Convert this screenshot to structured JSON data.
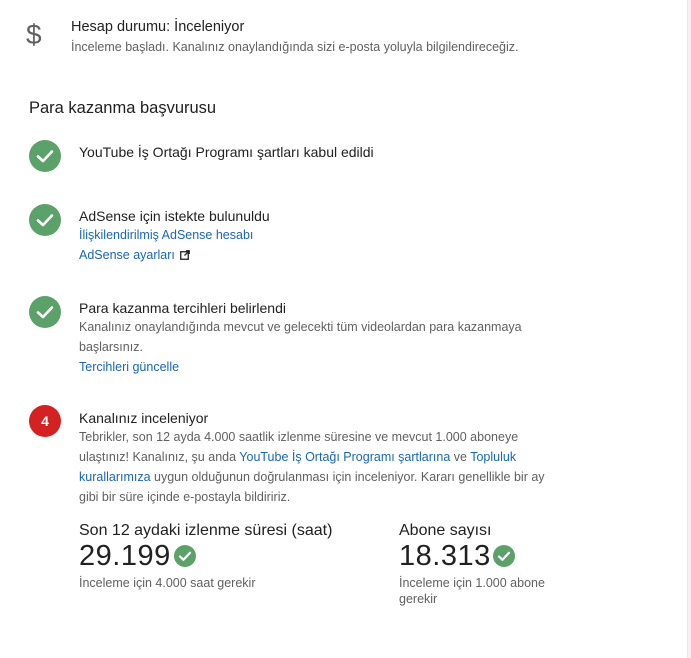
{
  "status": {
    "icon": "dollar-icon",
    "title": "Hesap durumu: İnceleniyor",
    "subtitle": "İnceleme başladı. Kanalınız onaylandığında sizi e-posta yoluyla bilgilendireceğiz."
  },
  "section_title": "Para kazanma başvurusu",
  "steps": [
    {
      "state": "done",
      "icon": "check-icon",
      "title": "YouTube İş Ortağı Programı şartları kabul edildi"
    },
    {
      "state": "done",
      "icon": "check-icon",
      "title": "AdSense için istekte bulunuldu",
      "links": [
        "İlişkilendirilmiş AdSense hesabı",
        "AdSense ayarları"
      ]
    },
    {
      "state": "done",
      "icon": "check-icon",
      "title": "Para kazanma tercihleri belirlendi",
      "desc": "Kanalınız onaylandığında mevcut ve gelecekti tüm videolardan para kazanmaya başlarsınız.",
      "link": "Tercihleri güncelle"
    },
    {
      "state": "current",
      "number": "4",
      "title": "Kanalınız inceleniyor",
      "desc_1": "Tebrikler, son 12 ayda 4.000 saatlik izlenme süresine ve mevcut 1.000 aboneye ulaştınız! Kanalınız, şu anda ",
      "link_1": "YouTube İş Ortağı Programı şartlarına",
      "desc_2": " ve ",
      "link_2": "Topluluk kurallarımıza",
      "desc_3": " uygun olduğunun doğrulanması için inceleniyor. Kararı genellikle bir ay gibi bir süre içinde e-postayla bildiririz."
    }
  ],
  "stats": [
    {
      "label": "Son 12 aydaki izlenme süresi (saat)",
      "value": "29.199",
      "note": "İnceleme için 4.000 saat gerekir"
    },
    {
      "label": "Abone sayısı",
      "value": "18.313",
      "note": "İnceleme için 1.000 abone gerekir"
    }
  ],
  "colors": {
    "check": "#5da16a",
    "current_step": "#d42121",
    "link": "#1a66b5"
  }
}
